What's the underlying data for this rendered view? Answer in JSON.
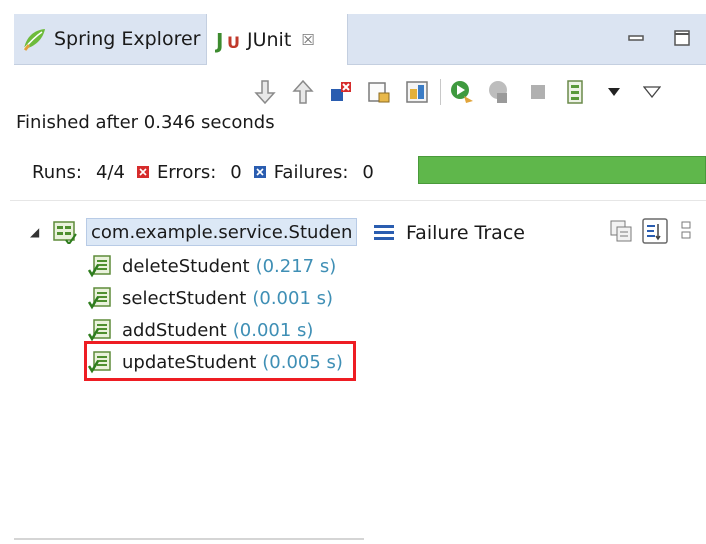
{
  "tabs": {
    "spring_explorer": "Spring Explorer",
    "junit": "JUnit",
    "close_glyph": "☒"
  },
  "status": {
    "finished": "Finished after 0.346 seconds"
  },
  "stats": {
    "runs_label": "Runs:",
    "runs_value": "4/4",
    "errors_label": "Errors:",
    "errors_value": "0",
    "failures_label": "Failures:",
    "failures_value": "0",
    "progress_fraction": 1.0,
    "progress_color": "#5fb74b"
  },
  "tree": {
    "root": {
      "label": "com.example.service.Studen"
    },
    "items": [
      {
        "name": "deleteStudent",
        "time": "(0.217 s)"
      },
      {
        "name": "selectStudent",
        "time": "(0.001 s)"
      },
      {
        "name": "addStudent",
        "time": "(0.001 s)"
      },
      {
        "name": "updateStudent",
        "time": "(0.005 s)"
      }
    ]
  },
  "failure_trace": {
    "title": "Failure Trace"
  },
  "icons": {
    "toolbar": [
      "next-failure-icon",
      "previous-failure-icon",
      "show-failures-only-icon",
      "scroll-lock-icon",
      "show-skipped-icon",
      "rerun-test-icon",
      "rerun-failed-first-icon",
      "stop-icon",
      "test-run-history-icon",
      "view-menu-icon"
    ],
    "tree_item": "junit-test-icon",
    "highlight_color": "#ee1d23"
  }
}
